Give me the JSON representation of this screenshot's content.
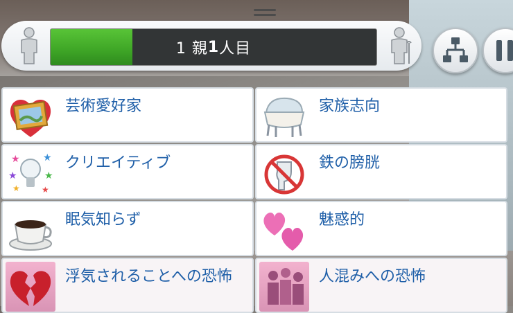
{
  "household": {
    "label_prefix": "1 親",
    "label_bold": "1",
    "label_suffix": "人目",
    "progress_fraction": 0.25,
    "fill_color": "#46b52b"
  },
  "buttons": {
    "family_tree_icon": "family-tree-icon",
    "pause_icon": "pause-icon"
  },
  "traits": [
    {
      "label": "芸術愛好家",
      "icon": "painting-frame-icon",
      "type": "positive"
    },
    {
      "label": "家族志向",
      "icon": "bassinet-icon",
      "type": "positive"
    },
    {
      "label": "クリエイティブ",
      "icon": "lightbulb-stars-icon",
      "type": "positive"
    },
    {
      "label": "鉄の膀胱",
      "icon": "no-toilet-icon",
      "type": "positive"
    },
    {
      "label": "眠気知らず",
      "icon": "coffee-cup-icon",
      "type": "positive"
    },
    {
      "label": "魅惑的",
      "icon": "hearts-icon",
      "type": "positive"
    },
    {
      "label": "浮気されることへの恐怖",
      "icon": "broken-heart-icon",
      "type": "negative"
    },
    {
      "label": "人混みへの恐怖",
      "icon": "crowd-icon",
      "type": "negative"
    }
  ]
}
